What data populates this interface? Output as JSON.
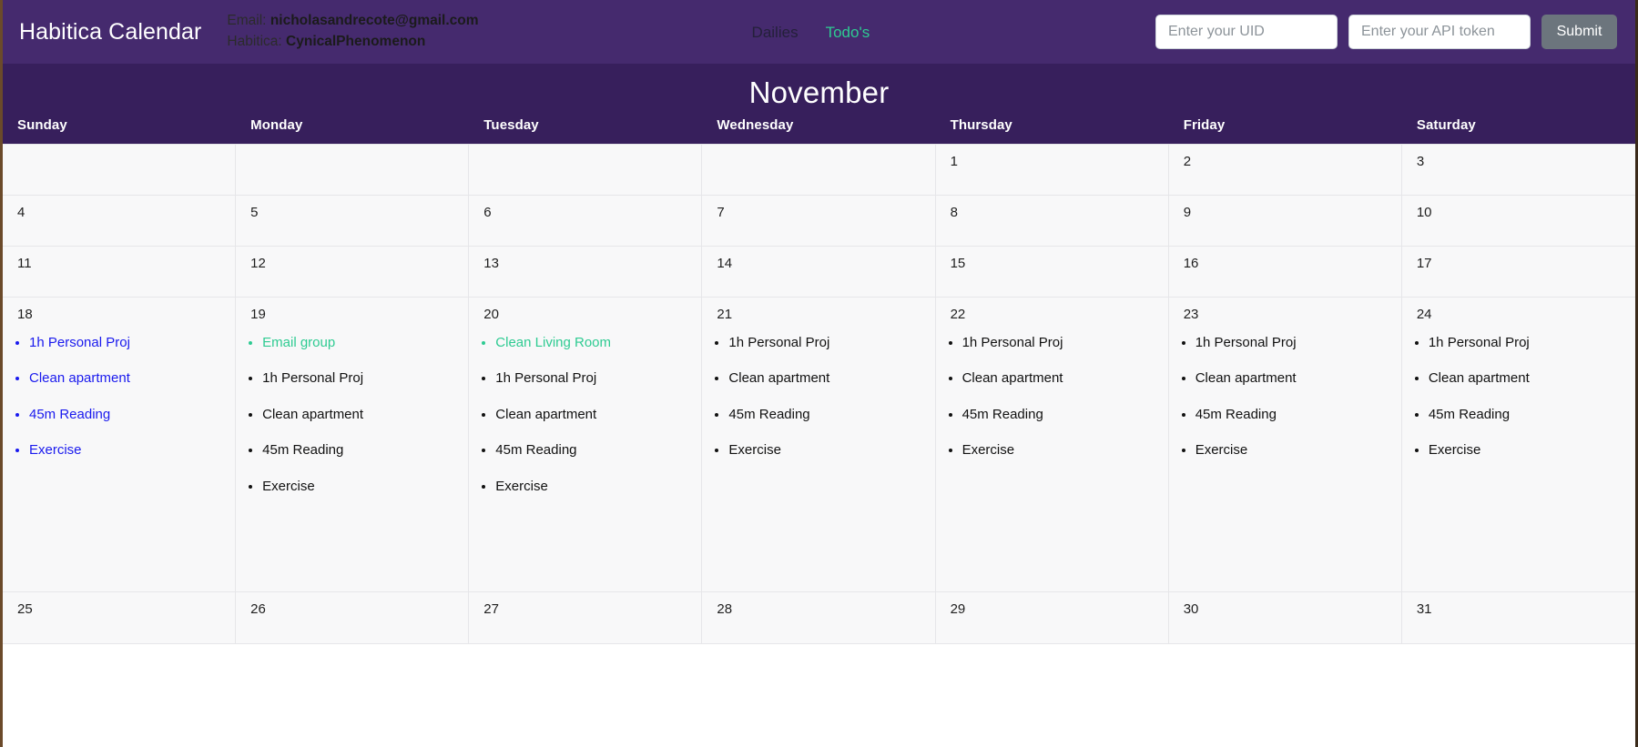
{
  "navbar": {
    "brand": "Habitica Calendar",
    "email_label": "Email:",
    "email_value": "nicholasandrecote@gmail.com",
    "habitica_label": "Habitica:",
    "habitica_value": "CynicalPhenomenon",
    "links": [
      {
        "label": "Dailies",
        "state": "inactive"
      },
      {
        "label": "Todo's",
        "state": "active"
      }
    ],
    "uid_placeholder": "Enter your UID",
    "uid_value": "",
    "token_placeholder": "Enter your API token",
    "token_value": "",
    "submit_label": "Submit"
  },
  "calendar": {
    "month": "November",
    "weekdays": [
      "Sunday",
      "Monday",
      "Tuesday",
      "Wednesday",
      "Thursday",
      "Friday",
      "Saturday"
    ],
    "colors": {
      "navbar_bg": "#452a6e",
      "header_bg": "#371f5c",
      "cell_bg": "#f8f8f9",
      "grid_line": "#e6e6e9",
      "accent_green": "#2ecb92",
      "link_blue": "#1a1aee",
      "task_black": "#111111",
      "submit_gray": "#6c757d"
    },
    "weeks": [
      {
        "kind": "r-empty",
        "days": [
          {
            "num": "",
            "tasks": []
          },
          {
            "num": "",
            "tasks": []
          },
          {
            "num": "",
            "tasks": []
          },
          {
            "num": "",
            "tasks": []
          },
          {
            "num": "1",
            "tasks": []
          },
          {
            "num": "2",
            "tasks": []
          },
          {
            "num": "3",
            "tasks": []
          }
        ]
      },
      {
        "kind": "r-short",
        "days": [
          {
            "num": "4",
            "tasks": []
          },
          {
            "num": "5",
            "tasks": []
          },
          {
            "num": "6",
            "tasks": []
          },
          {
            "num": "7",
            "tasks": []
          },
          {
            "num": "8",
            "tasks": []
          },
          {
            "num": "9",
            "tasks": []
          },
          {
            "num": "10",
            "tasks": []
          }
        ]
      },
      {
        "kind": "r-short",
        "days": [
          {
            "num": "11",
            "tasks": []
          },
          {
            "num": "12",
            "tasks": []
          },
          {
            "num": "13",
            "tasks": []
          },
          {
            "num": "14",
            "tasks": []
          },
          {
            "num": "15",
            "tasks": []
          },
          {
            "num": "16",
            "tasks": []
          },
          {
            "num": "17",
            "tasks": []
          }
        ]
      },
      {
        "kind": "r-tall",
        "days": [
          {
            "num": "18",
            "tasks": [
              {
                "label": "1h Personal Proj",
                "color": "blue"
              },
              {
                "label": "Clean apartment",
                "color": "blue"
              },
              {
                "label": "45m Reading",
                "color": "blue"
              },
              {
                "label": "Exercise",
                "color": "blue"
              }
            ]
          },
          {
            "num": "19",
            "tasks": [
              {
                "label": "Email group",
                "color": "green"
              },
              {
                "label": "1h Personal Proj",
                "color": "black"
              },
              {
                "label": "Clean apartment",
                "color": "black"
              },
              {
                "label": "45m Reading",
                "color": "black"
              },
              {
                "label": "Exercise",
                "color": "black"
              }
            ]
          },
          {
            "num": "20",
            "tasks": [
              {
                "label": "Clean Living Room",
                "color": "green"
              },
              {
                "label": "1h Personal Proj",
                "color": "black"
              },
              {
                "label": "Clean apartment",
                "color": "black"
              },
              {
                "label": "45m Reading",
                "color": "black"
              },
              {
                "label": "Exercise",
                "color": "black"
              }
            ]
          },
          {
            "num": "21",
            "tasks": [
              {
                "label": "1h Personal Proj",
                "color": "black"
              },
              {
                "label": "Clean apartment",
                "color": "black"
              },
              {
                "label": "45m Reading",
                "color": "black"
              },
              {
                "label": "Exercise",
                "color": "black"
              }
            ]
          },
          {
            "num": "22",
            "tasks": [
              {
                "label": "1h Personal Proj",
                "color": "black"
              },
              {
                "label": "Clean apartment",
                "color": "black"
              },
              {
                "label": "45m Reading",
                "color": "black"
              },
              {
                "label": "Exercise",
                "color": "black"
              }
            ]
          },
          {
            "num": "23",
            "tasks": [
              {
                "label": "1h Personal Proj",
                "color": "black"
              },
              {
                "label": "Clean apartment",
                "color": "black"
              },
              {
                "label": "45m Reading",
                "color": "black"
              },
              {
                "label": "Exercise",
                "color": "black"
              }
            ]
          },
          {
            "num": "24",
            "tasks": [
              {
                "label": "1h Personal Proj",
                "color": "black"
              },
              {
                "label": "Clean apartment",
                "color": "black"
              },
              {
                "label": "45m Reading",
                "color": "black"
              },
              {
                "label": "Exercise",
                "color": "black"
              }
            ]
          }
        ]
      },
      {
        "kind": "r-last",
        "days": [
          {
            "num": "25",
            "tasks": []
          },
          {
            "num": "26",
            "tasks": []
          },
          {
            "num": "27",
            "tasks": []
          },
          {
            "num": "28",
            "tasks": []
          },
          {
            "num": "29",
            "tasks": []
          },
          {
            "num": "30",
            "tasks": []
          },
          {
            "num": "31",
            "tasks": []
          }
        ]
      }
    ]
  }
}
